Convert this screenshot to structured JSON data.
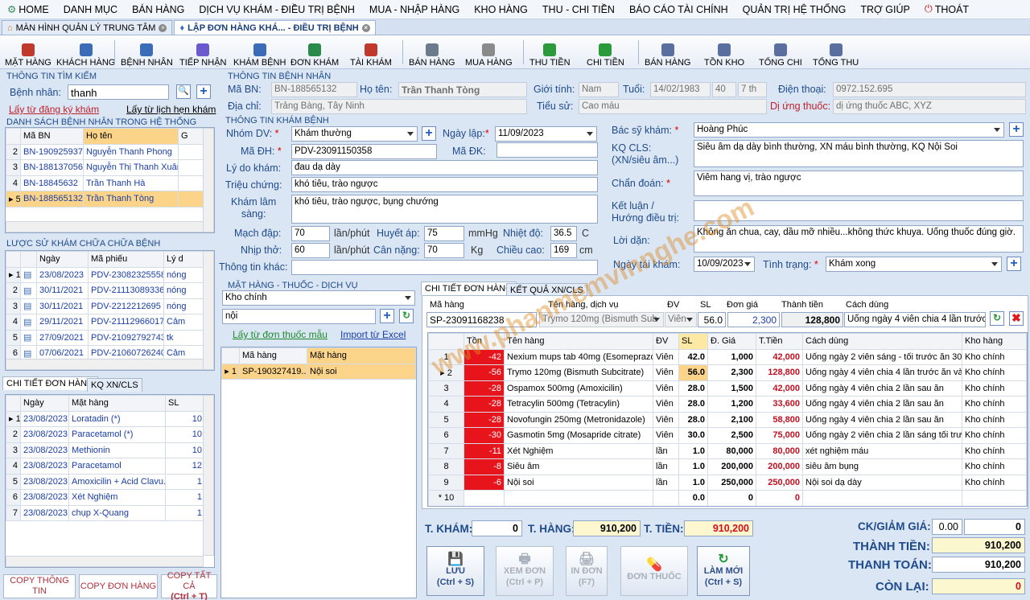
{
  "menu": [
    {
      "label": "HOME",
      "icon": "gear-icon"
    },
    {
      "label": "DANH MỤC"
    },
    {
      "label": "BÁN HÀNG"
    },
    {
      "label": "DỊCH VỤ KHÁM - ĐIỀU TRỊ BỆNH"
    },
    {
      "label": "MUA - NHẬP HÀNG"
    },
    {
      "label": "KHO HÀNG"
    },
    {
      "label": "THU - CHI TIỀN"
    },
    {
      "label": "BÁO CÁO TÀI CHÍNH"
    },
    {
      "label": "QUẢN TRỊ HỆ THỐNG"
    },
    {
      "label": "TRỢ GIÚP"
    },
    {
      "label": "THOÁT",
      "icon": "power-icon"
    }
  ],
  "doc_tabs": [
    {
      "label": "MÀN HÌNH QUẢN LÝ TRUNG TÂM"
    },
    {
      "label": "LẬP ĐƠN HÀNG KHÁ... - ĐIỀU TRỊ BỆNH"
    }
  ],
  "toolbar": [
    "MẶT HÀNG",
    "KHÁCH HÀNG",
    "BỆNH NHÂN",
    "TIẾP NHẬN",
    "KHÁM BỆNH",
    "ĐƠN KHÁM",
    "TÀI KHÁM",
    "BÁN HÀNG",
    "MUA HÀNG",
    "THU TIỀN",
    "CHI TIỀN",
    "BÁN HÀNG",
    "TỒN KHO",
    "TỔNG CHI",
    "TỔNG THU"
  ],
  "search": {
    "section": "THÔNG TIN TÌM KIẾM",
    "label": "Bệnh nhân:",
    "value": "thanh",
    "link_register": "Lấy từ đăng ký khám",
    "link_appt": "Lấy từ lịch hẹn khám"
  },
  "patient_list": {
    "section": "DANH SÁCH BỆNH NHÂN TRONG HỆ THỐNG",
    "headers": [
      "Mã BN",
      "Họ tên",
      "G"
    ],
    "rows": [
      {
        "no": "2",
        "ma": "BN-190925937...",
        "ten": "Nguyễn Thanh Phong"
      },
      {
        "no": "3",
        "ma": "BN-1881370564",
        "ten": "Nguyễn Thị Thanh Xuân"
      },
      {
        "no": "4",
        "ma": "BN-18845632",
        "ten": "Trần Thanh Hà"
      },
      {
        "no": "5",
        "ma": "BN-188565132",
        "ten": "Trần Thanh Tòng"
      }
    ]
  },
  "history": {
    "section": "LƯỢC SỬ KHÁM CHỮA CHỮA BỆNH",
    "headers": [
      "Ngày",
      "Mã phiếu",
      "Lý d"
    ],
    "rows": [
      {
        "no": "1",
        "ngay": "23/08/2023",
        "ma": "PDV-23082325558",
        "ly": "nóng"
      },
      {
        "no": "2",
        "ngay": "30/11/2021",
        "ma": "PDV-21113089336",
        "ly": "nóng"
      },
      {
        "no": "3",
        "ngay": "30/11/2021",
        "ma": "PDV-2212212695",
        "ly": "nóng"
      },
      {
        "no": "4",
        "ngay": "29/11/2021",
        "ma": "PDV-21112966017",
        "ly": "Cảm"
      },
      {
        "no": "5",
        "ngay": "27/09/2021",
        "ma": "PDV-21092792743",
        "ly": "tk"
      },
      {
        "no": "6",
        "ngay": "07/06/2021",
        "ma": "PDV-21060726240",
        "ly": "Cảm"
      }
    ]
  },
  "left_tabs": [
    "CHI TIẾT ĐƠN HÀNG",
    "KQ XN/CLS"
  ],
  "left_detail": {
    "headers": [
      "Ngày",
      "Mặt hàng",
      "SL"
    ],
    "rows": [
      {
        "no": "1",
        "ngay": "23/08/2023",
        "mh": "Loratadin (*)",
        "sl": "10"
      },
      {
        "no": "2",
        "ngay": "23/08/2023",
        "mh": "Paracetamol (*)",
        "sl": "10"
      },
      {
        "no": "3",
        "ngay": "23/08/2023",
        "mh": "Methionin",
        "sl": "10"
      },
      {
        "no": "4",
        "ngay": "23/08/2023",
        "mh": "Paracetamol",
        "sl": "12"
      },
      {
        "no": "5",
        "ngay": "23/08/2023",
        "mh": "Amoxicilin + Acid Clavu...",
        "sl": "1"
      },
      {
        "no": "6",
        "ngay": "23/08/2023",
        "mh": "Xét Nghiệm",
        "sl": "1"
      },
      {
        "no": "7",
        "ngay": "23/08/2023",
        "mh": "chụp X-Quang",
        "sl": "1"
      }
    ]
  },
  "left_buttons": {
    "copy_info": "COPY THÔNG TIN",
    "copy_order": "COPY ĐƠN HÀNG",
    "copy_all": "COPY TẤT CẢ",
    "copy_all_key": "(Ctrl + T)"
  },
  "patient": {
    "section": "THÔNG TIN BỆNH NHÂN",
    "ma_lbl": "Mã BN:",
    "ma": "BN-188565132",
    "ten_lbl": "Họ tên:",
    "ten": "Trần Thanh Tòng",
    "gt_lbl": "Giới tính:",
    "gt": "Nam",
    "tuoi_lbl": "Tuổi:",
    "dob": "14/02/1983",
    "age": "40",
    "month": "7 th",
    "dt_lbl": "Điện thoại:",
    "dt": "0972.152.695",
    "dc_lbl": "Địa chỉ:",
    "dc": "Trảng Bàng, Tây Ninh",
    "ts_lbl": "Tiểu sử:",
    "ts": "Cao máu",
    "du_lbl": "Dị ứng thuốc:",
    "du": "dị ứng thuốc ABC, XYZ"
  },
  "exam": {
    "section": "THÔNG TIN KHÁM BỆNH",
    "nhom_lbl": "Nhóm DV:",
    "nhom": "Khám thường",
    "ngay_lbl": "Ngày lập:",
    "ngay": "11/09/2023",
    "bs_lbl": "Bác sỹ khám:",
    "bs": "Hoàng Phúc",
    "madh_lbl": "Mã ĐH:",
    "madh": "PDV-23091150358",
    "madk_lbl": "Mã ĐK:",
    "madk": "",
    "kq_lbl": "KQ CLS:",
    "kq_lbl2": "(XN/siêu âm...)",
    "kq": "Siêu âm dạ dày bình thường, XN máu bình thường, KQ Nội Soi",
    "lydo_lbl": "Lý do khám:",
    "lydo": "đau dạ dày",
    "trieu_lbl": "Triệu chứng:",
    "trieu": "khó tiêu, trào ngược",
    "cd_lbl": "Chẩn đoán:",
    "cd": "Viêm hang vị,  trào ngược",
    "kls_lbl": "Khám lâm",
    "kls_lbl2": "sàng:",
    "kls": "khó tiêu, trào ngược, bụng chướng",
    "kl_lbl": "Kết luận /",
    "kl_lbl2": "Hướng điều trị:",
    "kl": "",
    "mach_lbl": "Mạch đập:",
    "mach": "70",
    "mach_u": "lần/phút",
    "ha_lbl": "Huyết áp:",
    "ha": "75",
    "ha_u": "mmHg",
    "nd_lbl": "Nhiệt độ:",
    "nd": "36.5",
    "nd_u": "C",
    "ld_lbl": "Lời dặn:",
    "ld": "Không ăn chua, cay, dầu mỡ nhiều...không thức khuya. Uống thuốc đúng giờ.",
    "nt_lbl": "Nhịp thở:",
    "nt": "60",
    "nt_u": "lần/phút",
    "cn_lbl": "Cân nặng:",
    "cn": "70",
    "cn_u": "Kg",
    "cc_lbl": "Chiều cao:",
    "cc": "169",
    "cc_u": "cm",
    "ttk_lbl": "Thông tin khác:",
    "ttk": "",
    "ntk_lbl": "Ngày tái khám:",
    "ntk": "10/09/2023",
    "tt_lbl": "Tình trạng:",
    "tt": "Khám xong"
  },
  "items_panel": {
    "section": "MẶT HÀNG - THUỐC - DỊCH VỤ",
    "kho": "Kho chính",
    "search": "nội",
    "link1": "Lấy từ đơn thuốc mẫu",
    "link2": "Import từ Excel",
    "headers": [
      "Mã hàng",
      "Mặt hàng"
    ],
    "rows": [
      {
        "no": "1",
        "ma": "SP-190327419...",
        "mh": "Nội soi"
      }
    ]
  },
  "order_tabs": [
    "CHI TIẾT ĐƠN HÀNG",
    "KẾT QUẢ XN/CLS"
  ],
  "entry": {
    "h_ma": "Mã hàng",
    "h_ten": "Tên hàng, dịch vụ",
    "h_dv": "ĐV",
    "h_sl": "SL",
    "h_dg": "Đơn giá",
    "h_tt": "Thành tiền",
    "h_cd": "Cách dùng",
    "ma": "SP-23091168238",
    "ten": "Trymo 120mg (Bismuth Sub",
    "dv": "Viên",
    "sl": "56.0",
    "dg": "2,300",
    "tt": "128,800",
    "cd": "Uống ngày 4 viên chia 4 lần trước ăn"
  },
  "order": {
    "headers": [
      "Tồn",
      "Tên hàng",
      "ĐV",
      "SL",
      "Đ. Giá",
      "T.Tiền",
      "Cách dùng",
      "Kho hàng"
    ],
    "rows": [
      {
        "no": "1",
        "ton": "-42",
        "ten": "Nexium mups tab 40mg (Esomeprazole)",
        "dv": "Viên",
        "sl": "42.0",
        "dg": "1,000",
        "tt": "42,000",
        "cd": "Uống ngày 2 viên sáng - tối trước ăn 30 phút",
        "kho": "Kho chính"
      },
      {
        "no": "2",
        "ton": "-56",
        "ten": "Trymo 120mg (Bismuth Subcitrate)",
        "dv": "Viên",
        "sl": "56.0",
        "dg": "2,300",
        "tt": "128,800",
        "cd": "Uống ngày 4 viên chia 4 lần trước ăn và trư...",
        "kho": "Kho chính"
      },
      {
        "no": "3",
        "ton": "-28",
        "ten": "Ospamox 500mg (Amoxicilin)",
        "dv": "Viên",
        "sl": "28.0",
        "dg": "1,500",
        "tt": "42,000",
        "cd": "Uống ngày 4 viên chia 2 lần sau ăn",
        "kho": "Kho chính"
      },
      {
        "no": "4",
        "ton": "-28",
        "ten": "Tetracylin 500mg (Tetracylin)",
        "dv": "Viên",
        "sl": "28.0",
        "dg": "1,200",
        "tt": "33,600",
        "cd": "Uống ngày 4 viên chia 2 lần sau ăn",
        "kho": "Kho chính"
      },
      {
        "no": "5",
        "ton": "-28",
        "ten": "Novofungin 250mg (Metronidazole)",
        "dv": "Viên",
        "sl": "28.0",
        "dg": "2,100",
        "tt": "58,800",
        "cd": "Uống ngày 4 viên chia 2 lần sau ăn",
        "kho": "Kho chính"
      },
      {
        "no": "6",
        "ton": "-30",
        "ten": "Gasmotin 5mg (Mosapride citrate)",
        "dv": "Viên",
        "sl": "30.0",
        "dg": "2,500",
        "tt": "75,000",
        "cd": "Uống ngày 2 viên chia 2 lần sáng tối trước ...",
        "kho": "Kho chính"
      },
      {
        "no": "7",
        "ton": "-11",
        "ten": "Xét Nghiệm",
        "dv": "lần",
        "sl": "1.0",
        "dg": "80,000",
        "tt": "80,000",
        "cd": "xét nghiệm máu",
        "kho": "Kho chính"
      },
      {
        "no": "8",
        "ton": "-8",
        "ten": "Siêu âm",
        "dv": "lần",
        "sl": "1.0",
        "dg": "200,000",
        "tt": "200,000",
        "cd": "siêu âm bụng",
        "kho": "Kho chính"
      },
      {
        "no": "9",
        "ton": "-6",
        "ten": "Nội soi",
        "dv": "lần",
        "sl": "1.0",
        "dg": "250,000",
        "tt": "250,000",
        "cd": "Nội soi dạ dày",
        "kho": "Kho chính"
      }
    ],
    "new_row": {
      "no": "10",
      "sl": "0.0",
      "dg": "0",
      "tt": "0"
    }
  },
  "totals": {
    "tkham_lbl": "T. KHÁM:",
    "tkham": "0",
    "thang_lbl": "T. HÀNG:",
    "thang": "910,200",
    "ttien_lbl": "T. TIỀN:",
    "ttien": "910,200",
    "ck_lbl": "CK/GIẢM GIÁ:",
    "ck_pct": "0.00",
    "ck": "0",
    "thanhtien_lbl": "THÀNH TIỀN:",
    "thanhtien": "910,200",
    "thanhtoan_lbl": "THANH TOÁN:",
    "thanhtoan": "910,200",
    "conlai_lbl": "CÒN LẠI:",
    "conlai": "0"
  },
  "actions": [
    {
      "label": "LƯU",
      "key": "(Ctrl + S)",
      "enabled": true,
      "icon": "save-icon"
    },
    {
      "label": "XEM ĐƠN",
      "key": "(Ctrl + P)",
      "enabled": false,
      "icon": "print-preview-icon"
    },
    {
      "label": "IN ĐƠN",
      "key": "(F7)",
      "enabled": false,
      "icon": "printer-icon"
    },
    {
      "label": "ĐƠN THUỐC",
      "key": "",
      "enabled": false,
      "icon": "pill-icon"
    },
    {
      "label": "LÀM MỚI",
      "key": "(Ctrl + S)",
      "enabled": true,
      "icon": "refresh-icon"
    }
  ],
  "watermark": "www.phanmemvinnghe.com",
  "colors": {
    "accent": "#1f4b8c",
    "selected_row": "#fbd48a",
    "negative_stock": "#e8141b",
    "sl_yellow": "#fde8a4"
  }
}
